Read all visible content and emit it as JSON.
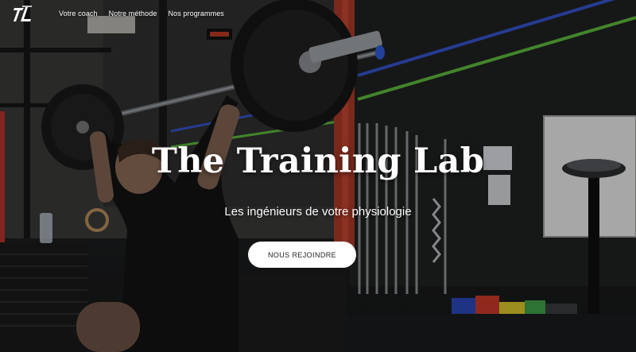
{
  "nav": {
    "logo_icon": "tl-monogram-icon",
    "links": [
      {
        "label": "Votre coach"
      },
      {
        "label": "Notre méthode"
      },
      {
        "label": "Nos programmes"
      }
    ]
  },
  "hero": {
    "title": "The Training Lab",
    "subtitle": "Les ingénieurs de votre physiologie",
    "cta_label": "NOUS REJOINDRE"
  },
  "colors": {
    "text": "#ffffff",
    "cta_background": "#ffffff",
    "cta_text": "#222222",
    "wall_stripe_blue": "#3553c9",
    "wall_stripe_green": "#5cb83c",
    "rack_red": "#c2452e"
  }
}
